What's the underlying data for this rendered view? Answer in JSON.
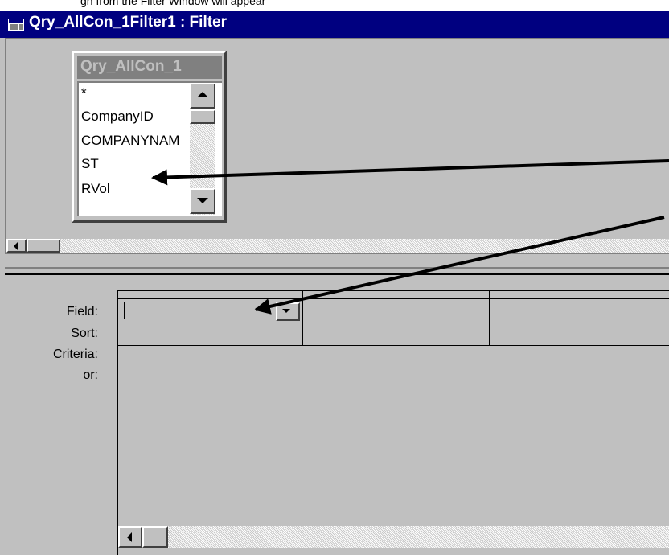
{
  "top_strip_text": "gn from the Filter Window will appear",
  "window": {
    "title": "Qry_AllCon_1Filter1 : Filter"
  },
  "field_list": {
    "title": "Qry_AllCon_1",
    "items": [
      "*",
      "CompanyID",
      "COMPANYNAM",
      "ST",
      "RVol"
    ]
  },
  "grid": {
    "row_labels": {
      "field": "Field:",
      "sort": "Sort:",
      "criteria": "Criteria:",
      "or": "or:"
    }
  },
  "icons": {
    "title_icon": "filter-window-icon",
    "scroll_up": "scroll-up-arrow-icon",
    "scroll_down": "scroll-down-arrow-icon",
    "scroll_left": "scroll-left-arrow-icon",
    "dropdown": "dropdown-arrow-icon"
  },
  "colors": {
    "titlebar": "#000080",
    "face": "#c0c0c0",
    "arrow": "#000000"
  }
}
